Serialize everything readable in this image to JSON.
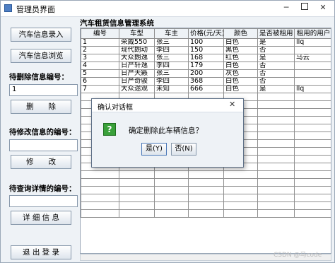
{
  "window": {
    "title": "管理员界面"
  },
  "sidebar": {
    "add_button": "汽车信息录入",
    "browse_button": "汽车信息浏览",
    "delete_label": "待删除信息编号：",
    "delete_value": "1",
    "delete_button": "删　　除",
    "edit_label": "待修改信息的编号：",
    "edit_value": "",
    "edit_button": "修　　改",
    "detail_label": "待查询详情的编号：",
    "detail_value": "",
    "detail_button": "详 细 信 息",
    "exit_button": "退 出 登 录"
  },
  "main": {
    "title": "汽车租赁信息管理系统"
  },
  "table": {
    "columns": [
      "编号",
      "车型",
      "车主",
      "价格(元/天)",
      "颜色",
      "是否被租用",
      "租用的用户"
    ],
    "rows": [
      [
        "1",
        "荣威550",
        "张三",
        "100",
        "白色",
        "是",
        "llq"
      ],
      [
        "2",
        "现代朗动",
        "李四",
        "150",
        "黑色",
        "否",
        ""
      ],
      [
        "3",
        "大众朗逸",
        "张三",
        "168",
        "红色",
        "是",
        "马云"
      ],
      [
        "4",
        "日产轩逸",
        "李四",
        "179",
        "白色",
        "否",
        ""
      ],
      [
        "5",
        "日产天籁",
        "张三",
        "200",
        "灰色",
        "否",
        ""
      ],
      [
        "6",
        "日产奇骏",
        "李四",
        "368",
        "白色",
        "否",
        ""
      ],
      [
        "7",
        "大众途观",
        "未知",
        "666",
        "白色",
        "是",
        "llq"
      ]
    ],
    "empty_rows": 16
  },
  "dialog": {
    "title": "确认对话框",
    "message": "确定删除此车辆信息？",
    "yes_button": "是(Y)",
    "no_button": "否(N)",
    "icon_glyph": "?"
  },
  "watermark": "CSDN @马code"
}
